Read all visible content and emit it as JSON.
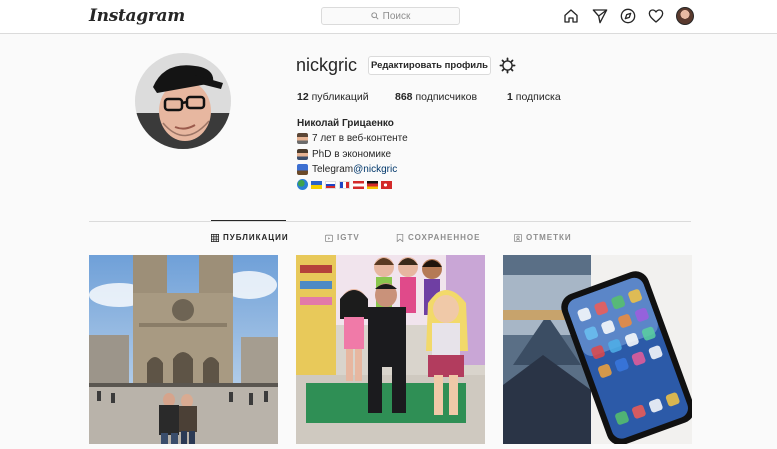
{
  "nav": {
    "logo": "Instagram",
    "search_placeholder": "Поиск",
    "icons": [
      "home-icon",
      "direct-icon",
      "explore-icon",
      "activity-heart-icon",
      "profile-avatar"
    ]
  },
  "profile": {
    "username": "nickgric",
    "edit_button": "Редактировать профиль",
    "stats": {
      "posts_count": "12",
      "posts_label": "публикаций",
      "followers_count": "868",
      "followers_label": "подписчиков",
      "following_count": "1",
      "following_label": "подписка"
    },
    "full_name": "Николай Грицаенко",
    "bio": [
      {
        "emoji": "man-technologist",
        "text": "7 лет в веб-контенте"
      },
      {
        "emoji": "man-teacher",
        "text": "PhD в экономике"
      },
      {
        "emoji": "mailbox",
        "text_prefix": "Telegram ",
        "link": "@nickgric"
      }
    ],
    "flags": [
      "globe",
      "ukraine",
      "russia",
      "france",
      "austria",
      "germany",
      "turkey"
    ]
  },
  "tabs": [
    {
      "label": "ПУБЛИКАЦИИ",
      "icon": "grid-icon",
      "active": true
    },
    {
      "label": "IGTV",
      "icon": "igtv-icon",
      "active": false
    },
    {
      "label": "СОХРАНЕННОЕ",
      "icon": "bookmark-icon",
      "active": false
    },
    {
      "label": "ОТМЕТКИ",
      "icon": "tagged-icon",
      "active": false
    }
  ],
  "posts": [
    {
      "description": "Notre-Dame de Paris with couple"
    },
    {
      "description": "Friends figures display with man"
    },
    {
      "description": "iPhone on Louvre photo"
    }
  ],
  "colors": {
    "background": "#fafafa",
    "border": "#dbdbdb",
    "text": "#262626",
    "muted": "#8e8e8e",
    "link": "#00376b"
  }
}
